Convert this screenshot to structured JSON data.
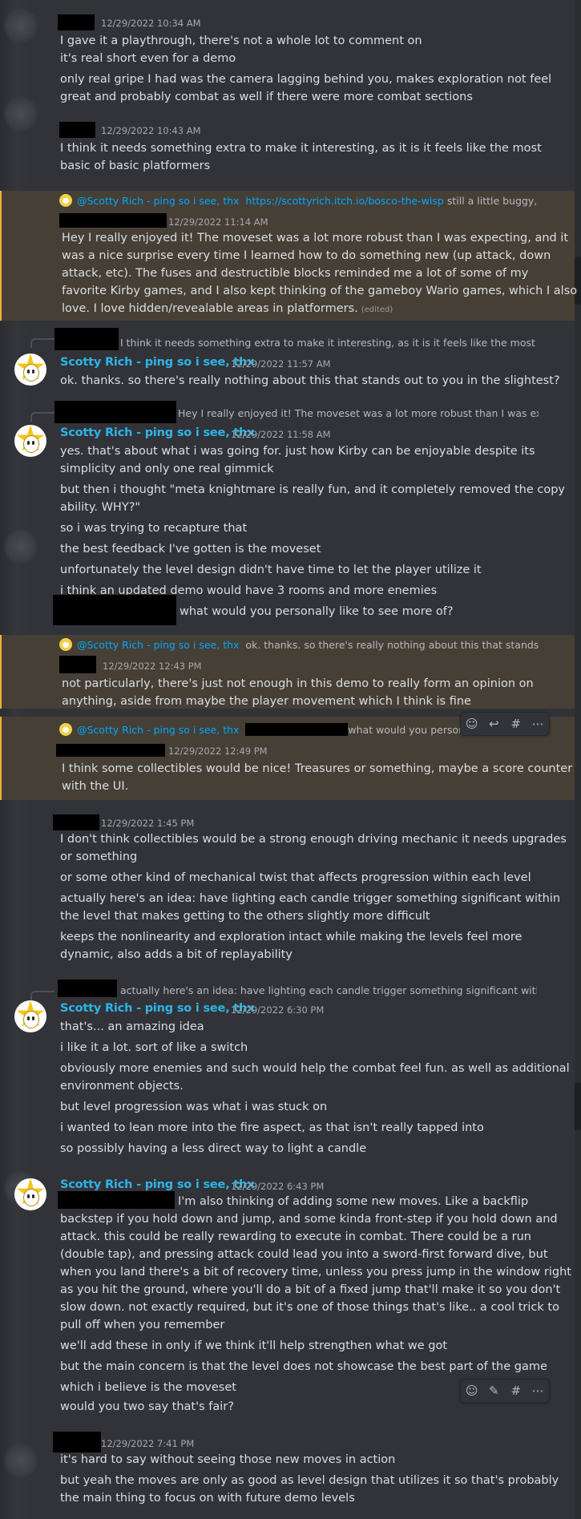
{
  "messages": {
    "m1": {
      "timestamp": "12/29/2022 10:34 AM",
      "lines": [
        "I gave it a playthrough, there's not a whole lot to comment on",
        "it's real short even for a demo",
        "only real gripe I had was the camera lagging behind you, makes exploration not feel",
        "great and probably combat as well if there were more combat sections"
      ]
    },
    "m2": {
      "timestamp": "12/29/2022 10:43 AM",
      "lines": [
        "I think it needs something extra to make it interesting, as it is it feels like the most",
        "basic of basic platformers"
      ]
    },
    "m3": {
      "reply_mention": "@Scotty Rich - ping so i see, thx",
      "reply_link": "https://scottyrich.itch.io/bosco-the-wisp",
      "reply_text": "still a little buggy,",
      "timestamp": "12/29/2022 11:14 AM",
      "lines": [
        "Hey I really enjoyed it! The moveset was a lot more robust than I was expecting, and it",
        "was a nice surprise every time I learned how to do something new (up attack, down",
        "attack, etc). The fuses and destructible blocks reminded me a lot of some of my",
        "favorite Kirby games, and I also kept thinking of the gameboy Wario games, which I also",
        "love. I love hidden/revealable areas in platformers."
      ],
      "edited": "(edited)"
    },
    "m4": {
      "reply_text": "I think it needs something extra to make it interesting, as it is it feels like the most basic",
      "author": "Scotty Rich - ping so i see, thx",
      "timestamp": "12/29/2022 11:57 AM",
      "lines": [
        "ok. thanks. so there's really nothing about this that stands out to you in the slightest?"
      ]
    },
    "m5": {
      "reply_text": "Hey I really enjoyed it! The moveset was a lot more robust than I was expect",
      "author": "Scotty Rich - ping so i see, thx",
      "timestamp": "12/29/2022 11:58 AM",
      "lines": [
        "yes. that's about what i was going for. just how Kirby can be enjoyable despite its",
        "simplicity and only one real gimmick",
        "but then i thought \"meta knightmare is really fun, and it completely removed the copy",
        "ability. WHY?\"",
        "so i was trying to recapture that",
        "the best feedback I've gotten is the moveset",
        "unfortunately the level design didn't have time to let the player utilize it",
        "i think an updated demo would have 3 rooms and more enemies",
        "what would you personally like to see more of?"
      ]
    },
    "m6": {
      "reply_mention": "@Scotty Rich - ping so i see, thx",
      "reply_text": "ok. thanks. so there's really nothing about this that stands out t",
      "timestamp": "12/29/2022 12:43 PM",
      "lines": [
        "not particularly, there's just not enough in this demo to really form an opinion on",
        "anything, aside from maybe the player movement which I think is fine"
      ]
    },
    "m7": {
      "reply_mention": "@Scotty Rich - ping so i see, thx",
      "reply_text": "what would you personally",
      "timestamp": "12/29/2022 12:49 PM",
      "lines": [
        "I think some collectibles would be nice! Treasures or something, maybe a score counter",
        "with the UI."
      ]
    },
    "m8": {
      "timestamp": "12/29/2022 1:45 PM",
      "lines": [
        "I don't think collectibles would be a strong enough driving mechanic it needs upgrades",
        "or something",
        "or some other kind of mechanical twist that affects progression within each level",
        "actually here's an idea: have lighting each candle trigger something significant within",
        "the level that makes getting to the others slightly more difficult",
        "keeps the nonlinearity and exploration intact while making the levels feel more",
        "dynamic, also adds a bit of replayability"
      ]
    },
    "m9": {
      "reply_text": "actually here's an idea: have lighting each candle trigger something significant within th",
      "author": "Scotty Rich - ping so i see, thx",
      "timestamp": "12/29/2022 6:30 PM",
      "lines": [
        "that's... an amazing idea",
        "i like it a lot. sort of like a switch",
        "obviously more enemies and such would help the combat feel fun. as well as additional",
        "environment objects.",
        "but level progression was what i was stuck on",
        "i wanted to lean more into the fire aspect, as that isn't really tapped into",
        "so possibly having a less direct way to light a candle"
      ]
    },
    "m10": {
      "author": "Scotty Rich - ping so i see, thx",
      "timestamp": "12/29/2022 6:43 PM",
      "lines": [
        "I'm also thinking of adding some new moves. Like a backflip",
        "backstep if you hold down and jump, and some kinda front-step if you hold down and",
        "attack. this could be really rewarding to execute in combat. There could be a run",
        "(double tap), and pressing attack could lead you into a sword-first forward dive, but",
        "when you land there's a bit of recovery time, unless you press jump in the window right",
        "as you hit the ground, where you'll do a bit of a fixed jump that'll make it so you don't",
        "slow down. not exactly required, but it's one of those things that's like.. a cool trick to",
        "pull off when you remember",
        "we'll add these in only if we think it'll help strengthen what we got",
        "but the main concern is that the level does not showcase the best part of the game",
        "which i believe is the moveset",
        "would you two say that's fair?"
      ]
    },
    "m11": {
      "timestamp": "12/29/2022 7:41 PM",
      "lines": [
        "it's hard to say without seeing those new moves in action",
        "but yeah the moves are only as good as level design that utilizes it so that's probably",
        "the main thing to focus on with future demo levels"
      ]
    }
  },
  "toolbar_icons": [
    "add-reaction-icon",
    "reply-icon",
    "create-thread-icon",
    "more-icon"
  ],
  "colors": {
    "background": "#313338",
    "highlight": "#453f36",
    "author": "#2eb4e6",
    "mention": "#00a8fc"
  }
}
